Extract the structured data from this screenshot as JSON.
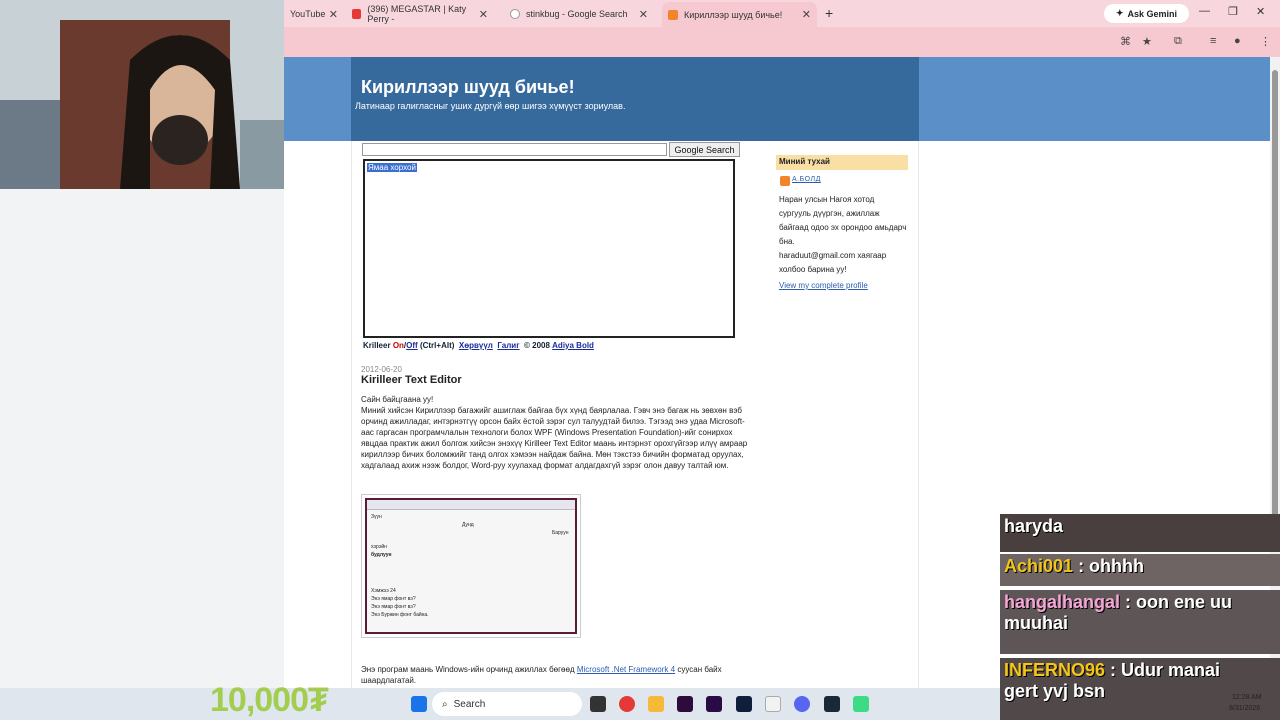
{
  "tabs": [
    {
      "label": "YouTube"
    },
    {
      "label": "(396) MEGASTAR | Katy Perry -"
    },
    {
      "label": "stinkbug - Google Search"
    },
    {
      "label": "Кириллээр шууд бичье!"
    }
  ],
  "gemini_label": "Ask Gemini",
  "blog": {
    "title": "Кириллээр шууд бичье!",
    "subtitle": "Латинаар галигласныг уших дургүй өөр шигээ хүмүүст зориулав.",
    "search_button": "Google Search",
    "editor_selected_text": "Ямаа хорхой",
    "toolbar": {
      "name": "Krilleer",
      "on": "On",
      "sep": "/",
      "off": "Off",
      "shortcut": "(Ctrl+Alt)",
      "link1": "Хөрвүүл",
      "link2": "Галиг",
      "copyright": "© 2008",
      "author": "Adiya Bold"
    },
    "post": {
      "date": "2012-06-20",
      "title": "Kirilleer Text Editor",
      "greeting": "Сайн байцгаана уу!",
      "body": "Миний хийсэн Кириллээр багажийг ашиглаж байгаа бүх хүнд баярлалаа. Гэвч энэ багаж нь зөвхөн вэб орчинд ажилладаг, интэрнэтгүү орсон байх ёстой зэрэг сул талуудтай билээ. Тэгээд энэ удаа Microsoft-аас гаргасан програмчлалын технологи болох WPF (Windows Presentation Foundation)-ийг сонирхох явцдаа практик ажил болгож хийсэн энэхүү Kirilleer Text Editor маань интэрнэт орохгүйгээр илүү амраар кириллээр бичих боломжийг танд олгох хэмээн найдаж байна. Мөн тэкстээ бичийн форматад оруулах, хадгалаад ахиж нээж болдог, Word-руу хуулахад формат алдагдахгүй зэрэг олон давуу талтай юм.",
      "footer_pre": "Энэ програм маань Windows-ийн орчинд ажиллах бөгөөд",
      "footer_link": "Microsoft .Net Framework 4",
      "footer_post": "суусан байх шаардлагатай."
    },
    "thumb_lines": [
      "Зүүн",
      "Дунд",
      "Баруун",
      "хэрэйн",
      "будлуун",
      "Хэмжээ 24",
      "Энэ ямар фонт вэ?",
      "Энэ ямар фонт вэ?",
      "Энэ Буржин фонт байна."
    ],
    "sidebar": {
      "title": "Миний тухай",
      "profile_name": "А.БОЛД",
      "about": "Наран улсын Нагоя хотод сургууль дүүргэн, ажиллаж байгаад одоо эх орондоо амьдарч бна.",
      "email_line": "haraduut@gmail.com хаягаар холбоо барина уу!",
      "profile_link": "View my complete profile"
    }
  },
  "chat": [
    {
      "user": "",
      "message": "haryda"
    },
    {
      "user": "Achi001",
      "message": ": ohhhh"
    },
    {
      "user": "hangalhangal",
      "message": ": oon ene uu"
    },
    {
      "user": "",
      "message": "muuhai"
    },
    {
      "user": "INFERNO96",
      "message": ": Udur manai"
    },
    {
      "user": "",
      "message": "gert yvj bsn"
    }
  ],
  "donation_text": "10,000₮",
  "taskbar": {
    "search_label": "Search",
    "time": "12:28 AM",
    "date": "8/31/2026"
  },
  "colors": {
    "accent_tab": "#f6c9d1",
    "blog_header": "#376a9c",
    "chat_green": "#8fc51a"
  }
}
